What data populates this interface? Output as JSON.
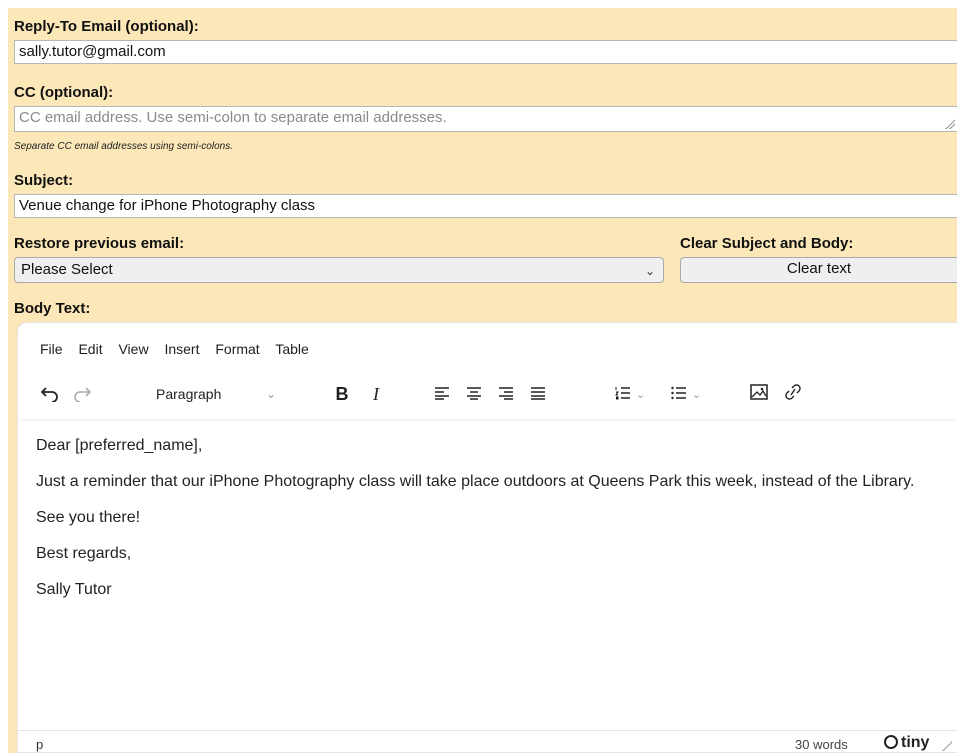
{
  "reply_to": {
    "label": "Reply-To Email (optional):",
    "value": "sally.tutor@gmail.com"
  },
  "cc": {
    "label": "CC (optional):",
    "placeholder": "CC email address. Use semi-colon to separate email addresses.",
    "hint": "Separate CC email addresses using semi-colons."
  },
  "subject": {
    "label": "Subject:",
    "value": "Venue change for iPhone Photography class"
  },
  "restore": {
    "label": "Restore previous email:",
    "selected": "Please Select"
  },
  "clear": {
    "label": "Clear Subject and Body:",
    "button": "Clear text"
  },
  "body": {
    "label": "Body Text:"
  },
  "editor": {
    "menu": [
      "File",
      "Edit",
      "View",
      "Insert",
      "Format",
      "Table"
    ],
    "block_format": "Paragraph",
    "toolbar_icons": [
      "undo-icon",
      "redo-icon",
      "bold-icon",
      "italic-icon",
      "align-left-icon",
      "align-center-icon",
      "align-right-icon",
      "align-justify-icon",
      "numbered-list-icon",
      "bullet-list-icon",
      "image-icon",
      "link-icon"
    ],
    "content": [
      "Dear [preferred_name],",
      "Just a reminder that our iPhone Photography class will take place outdoors at Queens Park this week, instead of the Library.",
      "See you there!",
      "Best regards,",
      "Sally Tutor"
    ],
    "status_path": "p",
    "word_count": "30 words",
    "brand": "tiny"
  },
  "colors": {
    "panel_bg": "#fbe7b8",
    "input_border": "#b6b6b6",
    "button_bg": "#efefef"
  }
}
